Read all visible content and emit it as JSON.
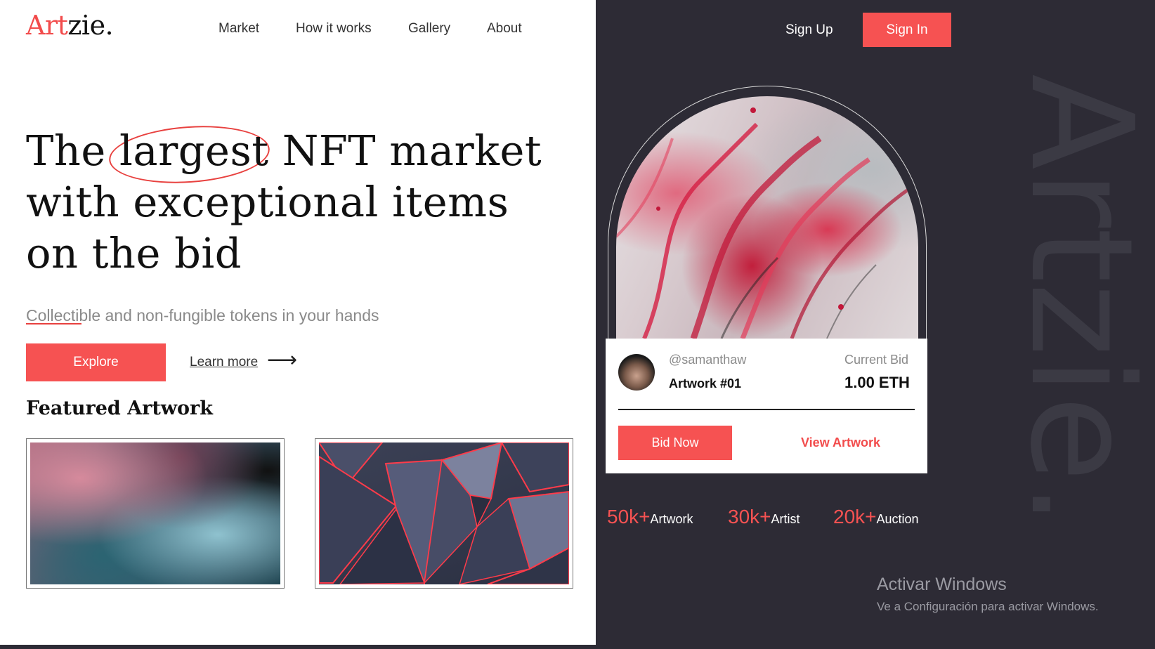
{
  "brand": {
    "logo_main": "Art",
    "logo_rest": "zie."
  },
  "nav": {
    "items": [
      {
        "label": "Market"
      },
      {
        "label": "How it works"
      },
      {
        "label": "Gallery"
      },
      {
        "label": "About"
      }
    ]
  },
  "auth": {
    "sign_up": "Sign Up",
    "sign_in": "Sign In"
  },
  "hero": {
    "line1_a": "The ",
    "line1_b": "largest",
    "line1_c": " NFT market",
    "line2": "with exceptional items",
    "line3": "on the bid",
    "subtitle": "Collectible and non-fungible tokens in your hands",
    "explore": "Explore",
    "learn_more": "Learn more",
    "arrow": "⟶"
  },
  "featured": {
    "title": "Featured Artwork"
  },
  "card": {
    "handle": "@samanthaw",
    "artwork": "Artwork #01",
    "bid_label": "Current Bid",
    "bid_value": "1.00 ETH",
    "bid_now": "Bid Now",
    "view_artwork": "View Artwork"
  },
  "stats": [
    {
      "num": "50k+",
      "label": "Artwork"
    },
    {
      "num": "30k+",
      "label": "Artist"
    },
    {
      "num": "20k+",
      "label": "Auction"
    }
  ],
  "vertical_logo": "Artzie.",
  "watermark": {
    "title": "Activar Windows",
    "subtitle": "Ve a Configuración para activar Windows."
  },
  "colors": {
    "accent": "#f65252",
    "dark_panel": "#2d2b35"
  }
}
